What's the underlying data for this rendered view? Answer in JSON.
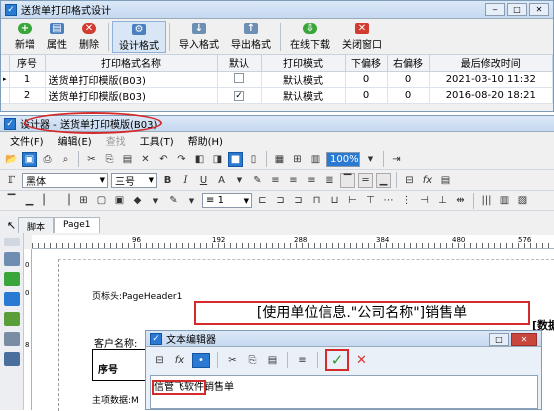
{
  "window1": {
    "title": "送货单打印格式设计",
    "icon": "app-icon",
    "toolbar": [
      {
        "label": "新增",
        "icon": "add-icon",
        "color": "#3aa53a"
      },
      {
        "label": "属性",
        "icon": "properties-icon",
        "color": "#4a7fc0"
      },
      {
        "label": "删除",
        "icon": "delete-icon",
        "color": "#d23b2f"
      },
      {
        "label": "设计格式",
        "icon": "design-icon",
        "color": "#4a7fc0"
      },
      {
        "label": "导入格式",
        "icon": "import-icon",
        "color": "#6c8fb3"
      },
      {
        "label": "导出格式",
        "icon": "export-icon",
        "color": "#6c8fb3"
      },
      {
        "label": "在线下载",
        "icon": "download-icon",
        "color": "#3aa53a"
      },
      {
        "label": "关闭窗口",
        "icon": "close-window-icon",
        "color": "#d23b2f"
      }
    ],
    "table": {
      "headers": [
        "序号",
        "打印格式名称",
        "默认",
        "打印模式",
        "下偏移",
        "右偏移",
        "最后修改时间"
      ],
      "rows": [
        {
          "seq": "1",
          "name": "送货单打印模版(B03)",
          "default": false,
          "mode": "默认模式",
          "down": "0",
          "right": "0",
          "time": "2021-03-10 11:32"
        },
        {
          "seq": "2",
          "name": "送货单打印模版(B03)",
          "default": true,
          "mode": "默认模式",
          "down": "0",
          "right": "0",
          "time": "2016-08-20 18:21"
        }
      ]
    }
  },
  "window2": {
    "title": "设计器 - 送货单打印模版(B03)",
    "menu": [
      "文件(F)",
      "编辑(E)",
      "查找",
      "工具(T)",
      "帮助(H)"
    ],
    "zoom": "100%",
    "font": "黑体",
    "fontsize": "三号",
    "linewidth": "1",
    "tabs": [
      "脚本",
      "Page1"
    ],
    "ruler": [
      "96",
      "192",
      "288",
      "384",
      "480",
      "576"
    ],
    "vruler": [
      "0",
      "0",
      "8"
    ],
    "page_header": "页标头:PageHeader1",
    "field_text": "[使用单位信息.\"公司名称\"]销售单",
    "partial_right": "[数据",
    "customer_label": "客户名称:",
    "seq_label": "序号",
    "data_label": "主项数据:M"
  },
  "text_editor": {
    "title": "文本编辑器",
    "content_highlight": "信管飞软件",
    "content_rest": "销售单"
  }
}
